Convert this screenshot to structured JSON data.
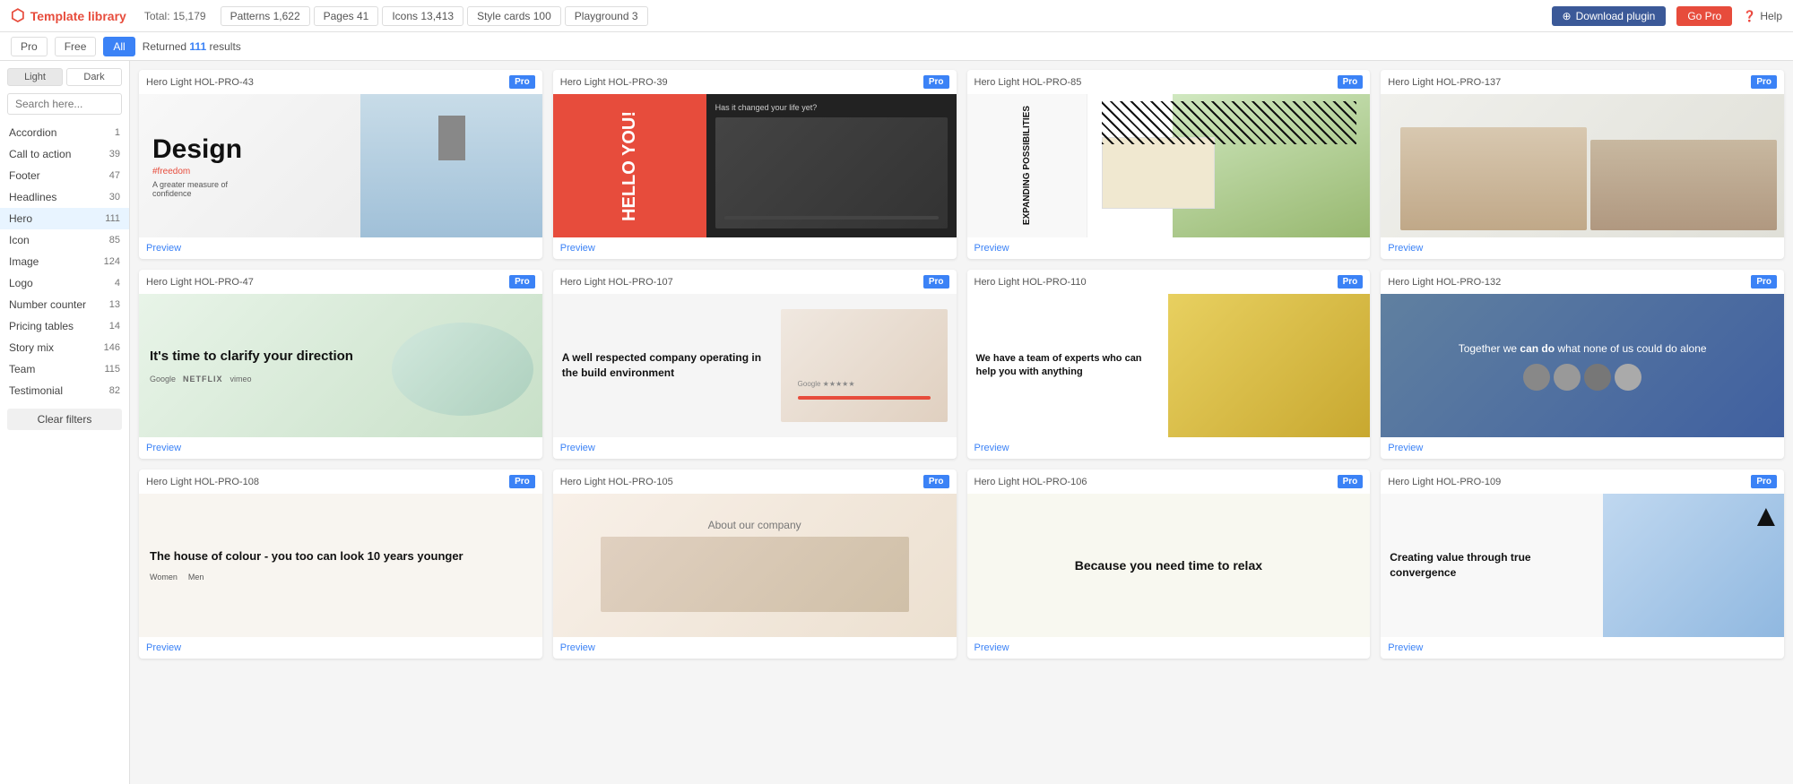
{
  "topbar": {
    "logo_text": "Template library",
    "total_label": "Total: 15,179",
    "nav_tabs": [
      {
        "label": "Patterns 1,622",
        "active": false
      },
      {
        "label": "Pages 41",
        "active": false
      },
      {
        "label": "Icons 13,413",
        "active": false
      },
      {
        "label": "Style cards 100",
        "active": false
      },
      {
        "label": "Playground 3",
        "active": false
      }
    ],
    "download_btn": "Download plugin",
    "gopro_btn": "Go Pro",
    "help_btn": "Help"
  },
  "second_bar": {
    "filter_pro": "Pro",
    "filter_free": "Free",
    "filter_all": "All",
    "results_prefix": "Returned ",
    "results_count": "111",
    "results_suffix": " results"
  },
  "sidebar": {
    "search_placeholder": "Search here...",
    "light_btn": "Light",
    "dark_btn": "Dark",
    "items": [
      {
        "label": "Accordion",
        "count": "1"
      },
      {
        "label": "Call to action",
        "count": "39"
      },
      {
        "label": "Footer",
        "count": "47"
      },
      {
        "label": "Headlines",
        "count": "30"
      },
      {
        "label": "Hero",
        "count": "111",
        "active": true
      },
      {
        "label": "Icon",
        "count": "85"
      },
      {
        "label": "Image",
        "count": "124"
      },
      {
        "label": "Logo",
        "count": "4"
      },
      {
        "label": "Number counter",
        "count": "13"
      },
      {
        "label": "Pricing tables",
        "count": "14"
      },
      {
        "label": "Story mix",
        "count": "146"
      },
      {
        "label": "Team",
        "count": "115"
      },
      {
        "label": "Testimonial",
        "count": "82"
      }
    ],
    "clear_filters": "Clear filters"
  },
  "cards": [
    {
      "id": "hol43",
      "title": "Hero Light HOL-PRO-43",
      "badge": "Pro",
      "preview_label": "Preview",
      "content": {
        "headline": "Design",
        "hashtag": "#freedom",
        "sub": "A greater measure of confidence"
      }
    },
    {
      "id": "hol39",
      "title": "Hero Light HOL-PRO-39",
      "badge": "Pro",
      "preview_label": "Preview",
      "content": {
        "headline": "HELLO YOU!",
        "sub": "Has it changed your life yet?"
      }
    },
    {
      "id": "hol85",
      "title": "Hero Light HOL-PRO-85",
      "badge": "Pro",
      "preview_label": "Preview",
      "content": {
        "headline": "EXPANDING POSSIBILITIES"
      }
    },
    {
      "id": "hol137",
      "title": "Hero Light HOL-PRO-137",
      "badge": "Pro",
      "preview_label": "Preview"
    },
    {
      "id": "hol47",
      "title": "Hero Light HOL-PRO-47",
      "badge": "Pro",
      "preview_label": "Preview",
      "content": {
        "headline": "It's time to clarify your direction"
      }
    },
    {
      "id": "hol107",
      "title": "Hero Light HOL-PRO-107",
      "badge": "Pro",
      "preview_label": "Preview",
      "content": {
        "headline": "A well respected company operating in the build environment"
      }
    },
    {
      "id": "hol110",
      "title": "Hero Light HOL-PRO-110",
      "badge": "Pro",
      "preview_label": "Preview",
      "content": {
        "headline": "We have a team of experts who can help you with anything"
      }
    },
    {
      "id": "hol132",
      "title": "Hero Light HOL-PRO-132",
      "badge": "Pro",
      "preview_label": "Preview",
      "content": {
        "headline": "Together we can do what none of us could do alone"
      }
    },
    {
      "id": "hol108",
      "title": "Hero Light HOL-PRO-108",
      "badge": "Pro",
      "preview_label": "Preview",
      "content": {
        "headline": "The house of colour - you too can look 10 years younger"
      }
    },
    {
      "id": "hol105",
      "title": "Hero Light HOL-PRO-105",
      "badge": "Pro",
      "preview_label": "Preview",
      "content": {
        "headline": "About our company"
      }
    },
    {
      "id": "hol106",
      "title": "Hero Light HOL-PRO-106",
      "badge": "Pro",
      "preview_label": "Preview",
      "content": {
        "headline": "Because you need time to relax"
      }
    },
    {
      "id": "hol109",
      "title": "Hero Light HOL-PRO-109",
      "badge": "Pro",
      "preview_label": "Preview",
      "content": {
        "headline": "Creating value through true convergence"
      }
    }
  ]
}
